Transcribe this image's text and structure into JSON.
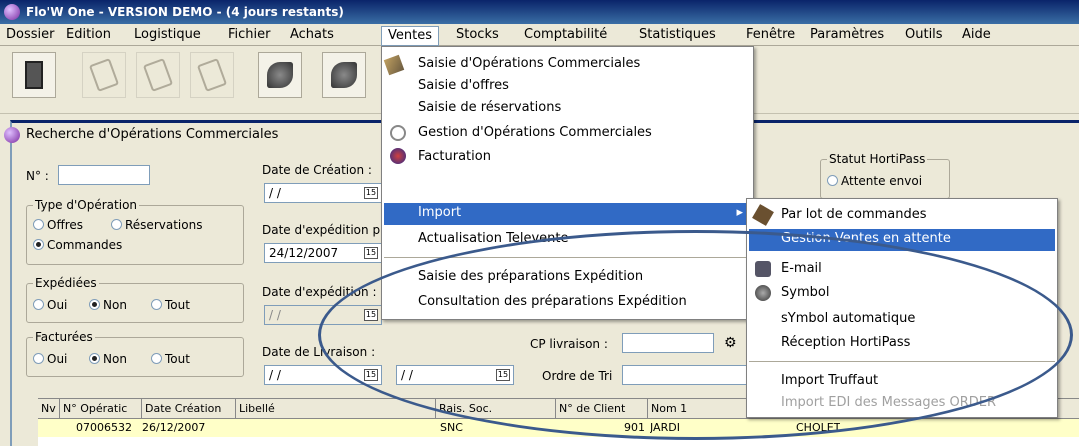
{
  "app": {
    "title": "Flo'W One - VERSION DEMO - (4 jours restants)"
  },
  "menubar": {
    "items": [
      "Dossier",
      "Edition",
      "Logistique",
      "Fichier",
      "Achats",
      "Ventes",
      "Stocks",
      "Comptabilité",
      "Statistiques",
      "Fenêtre",
      "Paramètres",
      "Outils",
      "Aide"
    ],
    "active": "Ventes"
  },
  "window": {
    "title": "Recherche d'Opérations Commerciales",
    "num_label": "N° :",
    "date_creation_label": "Date de Création :",
    "date_creation_value": "/ /",
    "date_expedition_p_label": "Date d'expédition p",
    "date_expedition_p_value": "24/12/2007",
    "date_expedition_label": "Date d'expédition :",
    "date_expedition_value": "/ /",
    "date_livraison_label": "Date de Livraison :",
    "date_livraison_value": "/ /",
    "date_livraison_value2": "/ /",
    "cp_livraison_label": "CP livraison :",
    "ordre_tri_label": "Ordre de Tri",
    "calendar_glyph": "15",
    "type_op": {
      "title": "Type d'Opération",
      "offres": "Offres",
      "reservations": "Réservations",
      "commandes": "Commandes"
    },
    "expediees": {
      "title": "Expédiées",
      "oui": "Oui",
      "non": "Non",
      "tout": "Tout"
    },
    "facturees": {
      "title": "Facturées",
      "oui": "Oui",
      "non": "Non",
      "tout": "Tout"
    },
    "statut": {
      "title": "Statut HortiPass",
      "attente": "Attente envoi"
    }
  },
  "grid": {
    "headers": [
      "Nv",
      "N° Opératic",
      "Date Création",
      "Libellé",
      "Rais. Soc.",
      "N° de Client",
      "Nom 1"
    ],
    "rows": [
      {
        "op": "07006532",
        "date": "26/12/2007",
        "rais": "SNC",
        "client": "901",
        "nom": "JARDI",
        "ville": "CHOLET"
      }
    ]
  },
  "ventes_menu": {
    "items": [
      "Saisie d'Opérations Commerciales",
      "Saisie d'offres",
      "Saisie de réservations",
      "Gestion d'Opérations Commerciales",
      "Facturation",
      "Import",
      "Actualisation Televente",
      "Saisie des préparations Expédition",
      "Consultation des préparations Expédition"
    ],
    "highlighted": "Import",
    "submenu_arrow": "▸"
  },
  "import_menu": {
    "items": [
      "Par lot de commandes",
      "Gestion Ventes en attente",
      "E-mail",
      "Symbol",
      "sYmbol automatique",
      "Réception HortiPass",
      "Import Truffaut",
      "Import EDI des Messages ORDER"
    ],
    "highlighted": "Gestion Ventes en attente",
    "disabled": "Import EDI des Messages ORDER"
  },
  "colors": {
    "highlight": "#316ac5",
    "titlebar": "#0a246a",
    "annotation_ellipse": "#3b5a8c",
    "row_bg": "#ffffc8"
  }
}
